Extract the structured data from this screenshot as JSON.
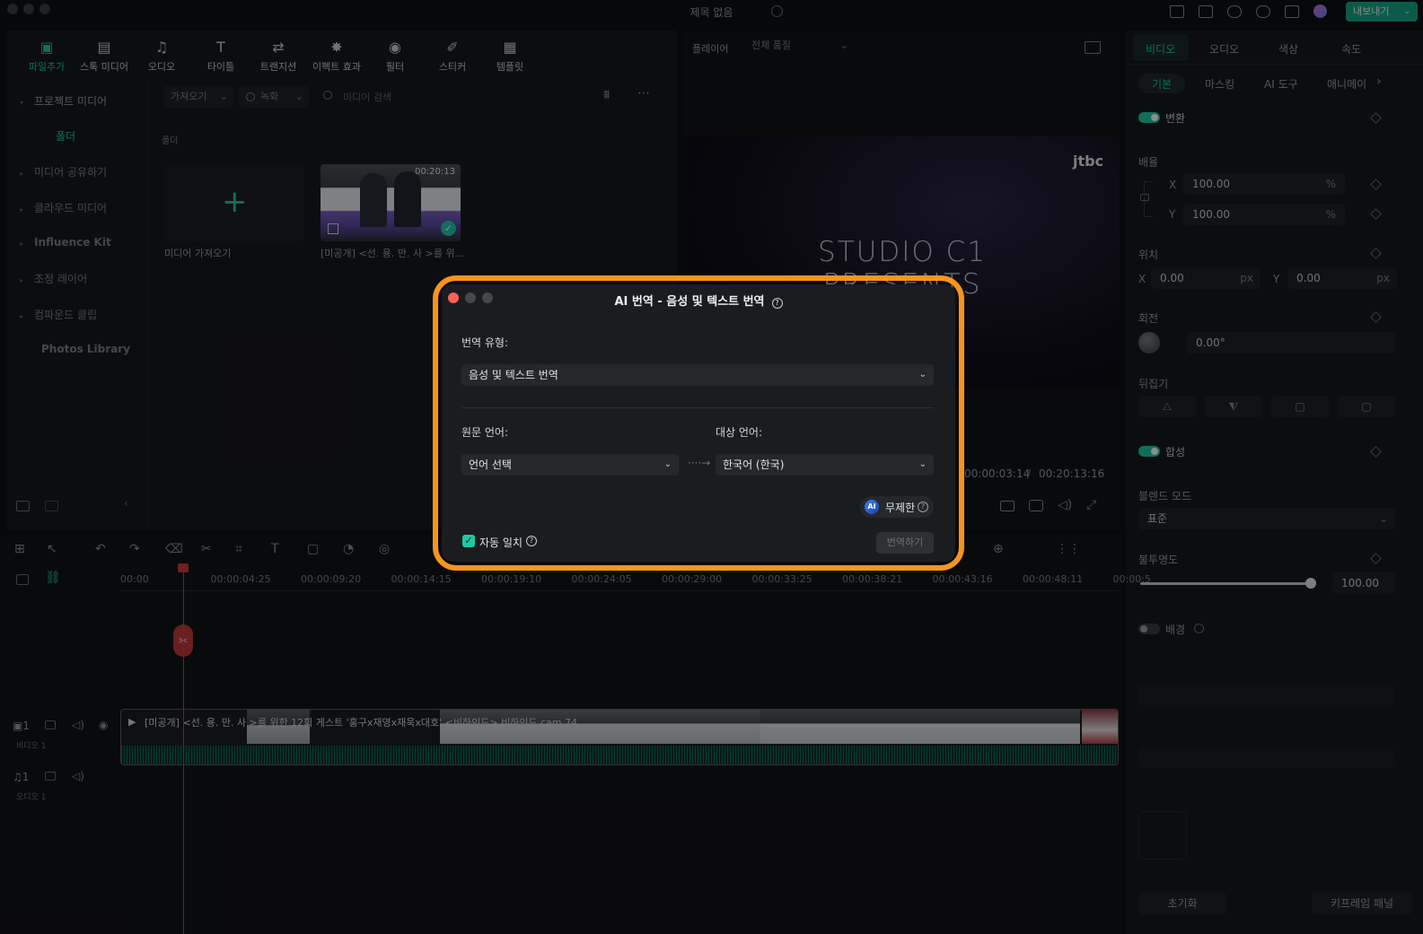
{
  "app": {
    "title": "제목 없음",
    "export_label": "내보내기"
  },
  "media_tabs": [
    {
      "label": "파일추가",
      "icon": "image-icon",
      "active": true
    },
    {
      "label": "스톡 미디어",
      "icon": "stock-media-icon"
    },
    {
      "label": "오디오",
      "icon": "music-note-icon"
    },
    {
      "label": "타이틀",
      "icon": "text-t-icon"
    },
    {
      "label": "트랜지션",
      "icon": "transition-icon"
    },
    {
      "label": "이펙트 효과",
      "icon": "sparkle-icon"
    },
    {
      "label": "필터",
      "icon": "filter-icon"
    },
    {
      "label": "스티커",
      "icon": "sticker-icon"
    },
    {
      "label": "템플릿",
      "icon": "template-icon"
    }
  ],
  "sidebar": {
    "items": [
      "프로젝트 미디어",
      "폴더",
      "미디어 공유하기",
      "클라우드 미디어",
      "Influence Kit",
      "조정 레이어",
      "컴파운드 클립",
      "Photos Library"
    ]
  },
  "media_toolbar": {
    "import": "가져오기",
    "record": "녹화",
    "search_placeholder": "미디어 검색"
  },
  "media": {
    "folder_label": "폴더",
    "import_tile_label": "미디어 가져오기",
    "clip_title": "[미공개] <선. 용. 만. 사 >를 위...",
    "clip_duration": "00:20:13"
  },
  "player": {
    "label": "플레이어",
    "quality": "전체 품질",
    "video_title": "STUDIO C1 PRESENTS",
    "logo": "jtbc",
    "current_time": "00:00:03:14",
    "total_time": "00:20:13:16"
  },
  "inspector": {
    "tabs": [
      "비디오",
      "오디오",
      "색상",
      "속도"
    ],
    "subtabs": [
      "기본",
      "마스킹",
      "AI 도구",
      "애니메이"
    ],
    "transform": "변환",
    "scale": "배율",
    "scale_x": "100.00",
    "scale_y": "100.00",
    "percent": "%",
    "position": "위치",
    "pos_x": "0.00",
    "pos_y": "0.00",
    "px": "px",
    "rotation": "회전",
    "rotation_value": "0.00°",
    "flip": "뒤집기",
    "compositing": "합성",
    "blend_mode_label": "블렌드 모드",
    "blend_mode": "표준",
    "opacity_label": "불투명도",
    "opacity": "100.00",
    "opacity_fraction": 1.0,
    "background": "배경",
    "reset": "초기화",
    "keyframe_panel": "키프레임 패널",
    "x": "X",
    "y": "Y"
  },
  "timeline": {
    "ruler": [
      "00:00",
      "00:00:04:25",
      "00:00:09:20",
      "00:00:14:15",
      "00:00:19:10",
      "00:00:24:05",
      "00:00:29:00",
      "00:00:33:25",
      "00:00:38:21",
      "00:00:43:16",
      "00:00:48:11",
      "00:00:5"
    ],
    "video_track": "비디오 1",
    "audio_track": "오디오 1",
    "clip_label": "[미공개] <선. 용. 만. 사 >를 위한 12회 게스트 '홍구x재영x재욱x대호' <비하인드> 비하인드 cam 74"
  },
  "dialog": {
    "title": "AI 번역 - 음성 및 텍스트 번역",
    "type_label": "번역 유형:",
    "type_value": "음성 및 텍스트 번역",
    "source_label": "원문 언어:",
    "source_value": "언어 선택",
    "target_label": "대상 언어:",
    "target_value": "한국어 (한국)",
    "credit_badge": "AI",
    "credit_label": "무제한",
    "auto_match": "자동 일치",
    "translate_button": "번역하기"
  },
  "colors": {
    "accent": "#1fc8a5",
    "highlight": "#f7941d",
    "close": "#fe5f57"
  }
}
